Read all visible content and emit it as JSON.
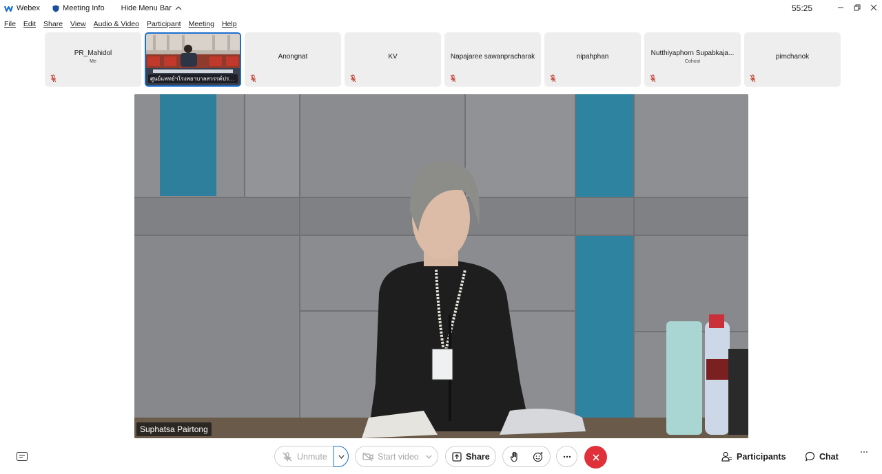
{
  "titlebar": {
    "app_name": "Webex",
    "meeting_info": "Meeting Info",
    "hide_menu_bar": "Hide Menu Bar",
    "timer": "55:25"
  },
  "menu": [
    "File",
    "Edit",
    "Share",
    "View",
    "Audio & Video",
    "Participant",
    "Meeting",
    "Help"
  ],
  "participants": [
    {
      "name": "PR_Mahidol",
      "sub": "Me",
      "muted": true
    },
    {
      "name": "ศูนย์แพทย์ฯโรงพยาบาลสวรรค์ประ...",
      "video": true
    },
    {
      "name": "Anongnat",
      "muted": true
    },
    {
      "name": "KV",
      "muted": true
    },
    {
      "name": "Napajaree sawanpracharak",
      "muted": true
    },
    {
      "name": "nipahphan",
      "muted": true
    },
    {
      "name": "Nutthiyaphorn Supabkaja...",
      "sub": "Cohost",
      "muted": true
    },
    {
      "name": "pimchanok",
      "muted": true
    }
  ],
  "stage": {
    "speaker_name": "Suphatsa Pairtong"
  },
  "controls": {
    "unmute": "Unmute",
    "start_video": "Start video",
    "share": "Share",
    "participants": "Participants",
    "chat": "Chat"
  },
  "colors": {
    "accent_blue": "#1b6fd0",
    "end_call_red": "#e0303a",
    "mic_off_red": "#c0392b",
    "tile_bg": "#eeeeee"
  },
  "icons": {
    "cc": "closed-captions-icon",
    "mic": "mic-off-icon",
    "camera": "camera-off-icon",
    "share": "share-icon",
    "raise_hand": "raise-hand-icon",
    "reactions": "reactions-icon",
    "more": "more-icon",
    "end": "end-call-icon",
    "participants": "participants-icon",
    "chat": "chat-icon"
  }
}
